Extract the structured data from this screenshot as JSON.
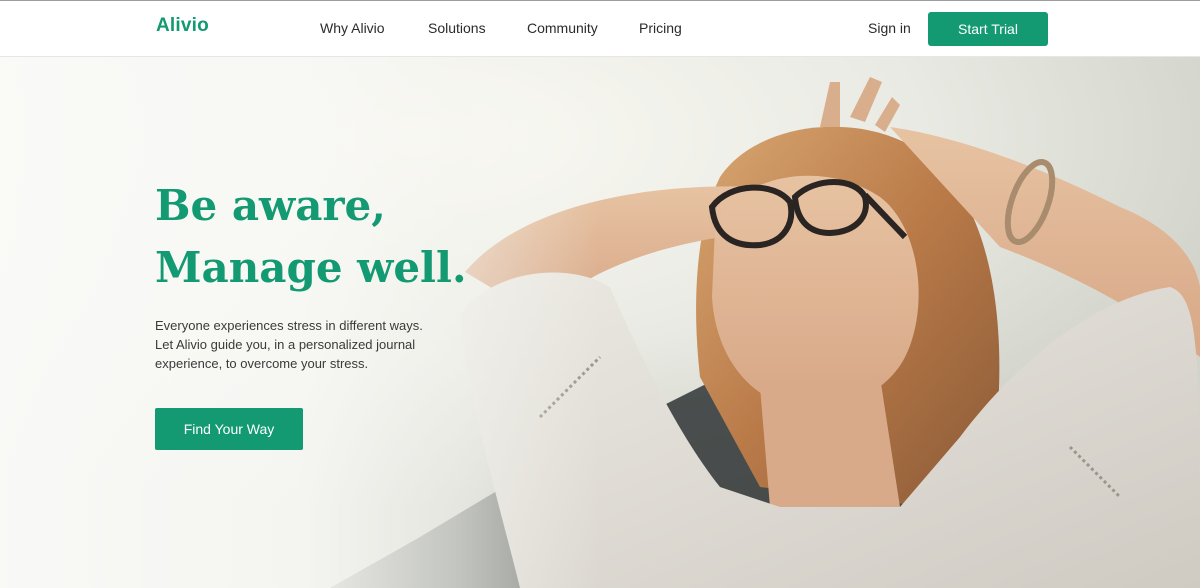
{
  "brand": {
    "name": "Alivio",
    "accent": "#139a72"
  },
  "nav": {
    "links": [
      {
        "label": "Why Alivio"
      },
      {
        "label": "Solutions"
      },
      {
        "label": "Community"
      },
      {
        "label": "Pricing"
      }
    ],
    "sign_in": "Sign in",
    "start_trial": "Start Trial"
  },
  "hero": {
    "headline_line1": "Be aware,",
    "headline_line2": "Manage well.",
    "subtext_line1": "Everyone experiences stress in different ways.",
    "subtext_line2": "Let Alivio guide you, in a personalized journal",
    "subtext_line3": "experience, to overcome your stress.",
    "cta": "Find Your Way",
    "image": "woman-relaxing-photo"
  }
}
